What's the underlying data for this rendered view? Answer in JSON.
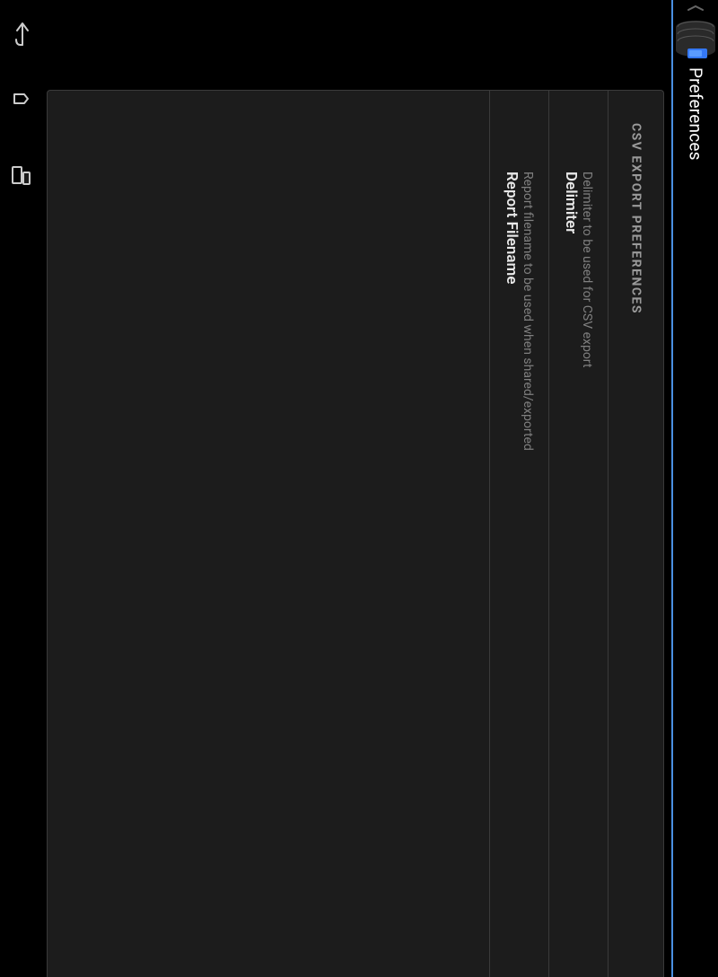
{
  "header": {
    "title": "Preferences"
  },
  "section": {
    "title": "CSV EXPORT PREFERENCES",
    "rows": [
      {
        "title": "Delimiter",
        "subtitle": "Delimiter to be used for CSV export"
      },
      {
        "title": "Report Filename",
        "subtitle": "Report filename to be used when shared/exported"
      }
    ]
  },
  "colors": {
    "accent": "#4a90e2",
    "bg": "#000000",
    "panel": "#1c1c1c",
    "border": "#3a3a3a"
  }
}
